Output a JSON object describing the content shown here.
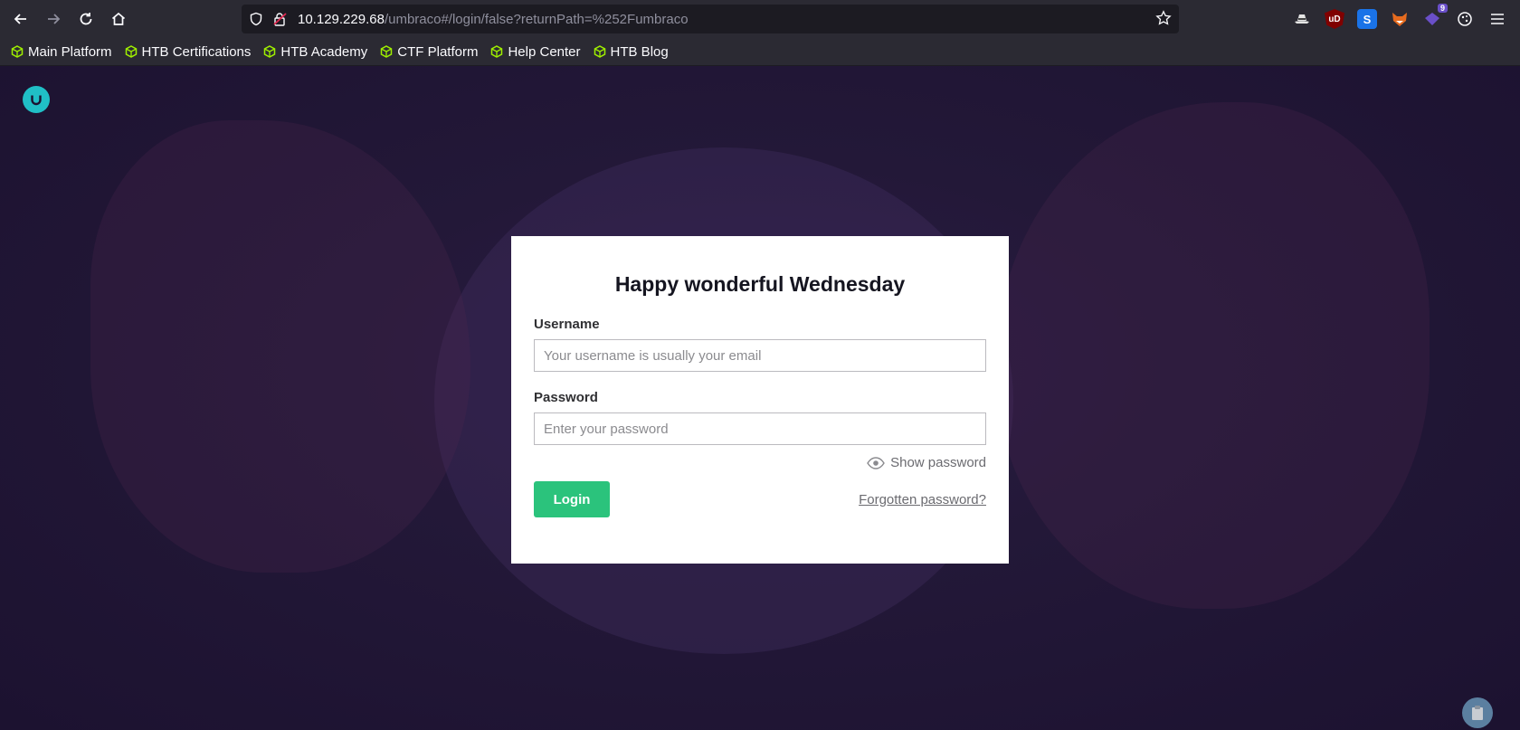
{
  "browser": {
    "url_host": "10.129.229.68",
    "url_path": "/umbraco#/login/false?returnPath=%252Fumbraco",
    "extensions": [
      {
        "name": "hat-icon",
        "color": "#e5e5e5"
      },
      {
        "name": "ublock-icon",
        "label": "uD",
        "color": "#800000"
      },
      {
        "name": "s-extension-icon",
        "label": "S",
        "color": "#1a73e8"
      },
      {
        "name": "fox-icon",
        "color": "#e66b1f"
      },
      {
        "name": "wappalyzer-icon",
        "badge": "9",
        "color": "#6a4fc9"
      },
      {
        "name": "cookie-icon",
        "color": "#fbfbfe"
      }
    ]
  },
  "bookmarks": [
    {
      "label": "Main Platform"
    },
    {
      "label": "HTB Certifications"
    },
    {
      "label": "HTB Academy"
    },
    {
      "label": "CTF Platform"
    },
    {
      "label": "Help Center"
    },
    {
      "label": "HTB Blog"
    }
  ],
  "login": {
    "greeting": "Happy wonderful Wednesday",
    "username_label": "Username",
    "username_placeholder": "Your username is usually your email",
    "password_label": "Password",
    "password_placeholder": "Enter your password",
    "show_password": "Show password",
    "login_button": "Login",
    "forgot_link": "Forgotten password?"
  },
  "colors": {
    "accent_green": "#2bc37c",
    "umbraco_teal": "#20bfc6",
    "bookmark_green": "#9fef00"
  }
}
